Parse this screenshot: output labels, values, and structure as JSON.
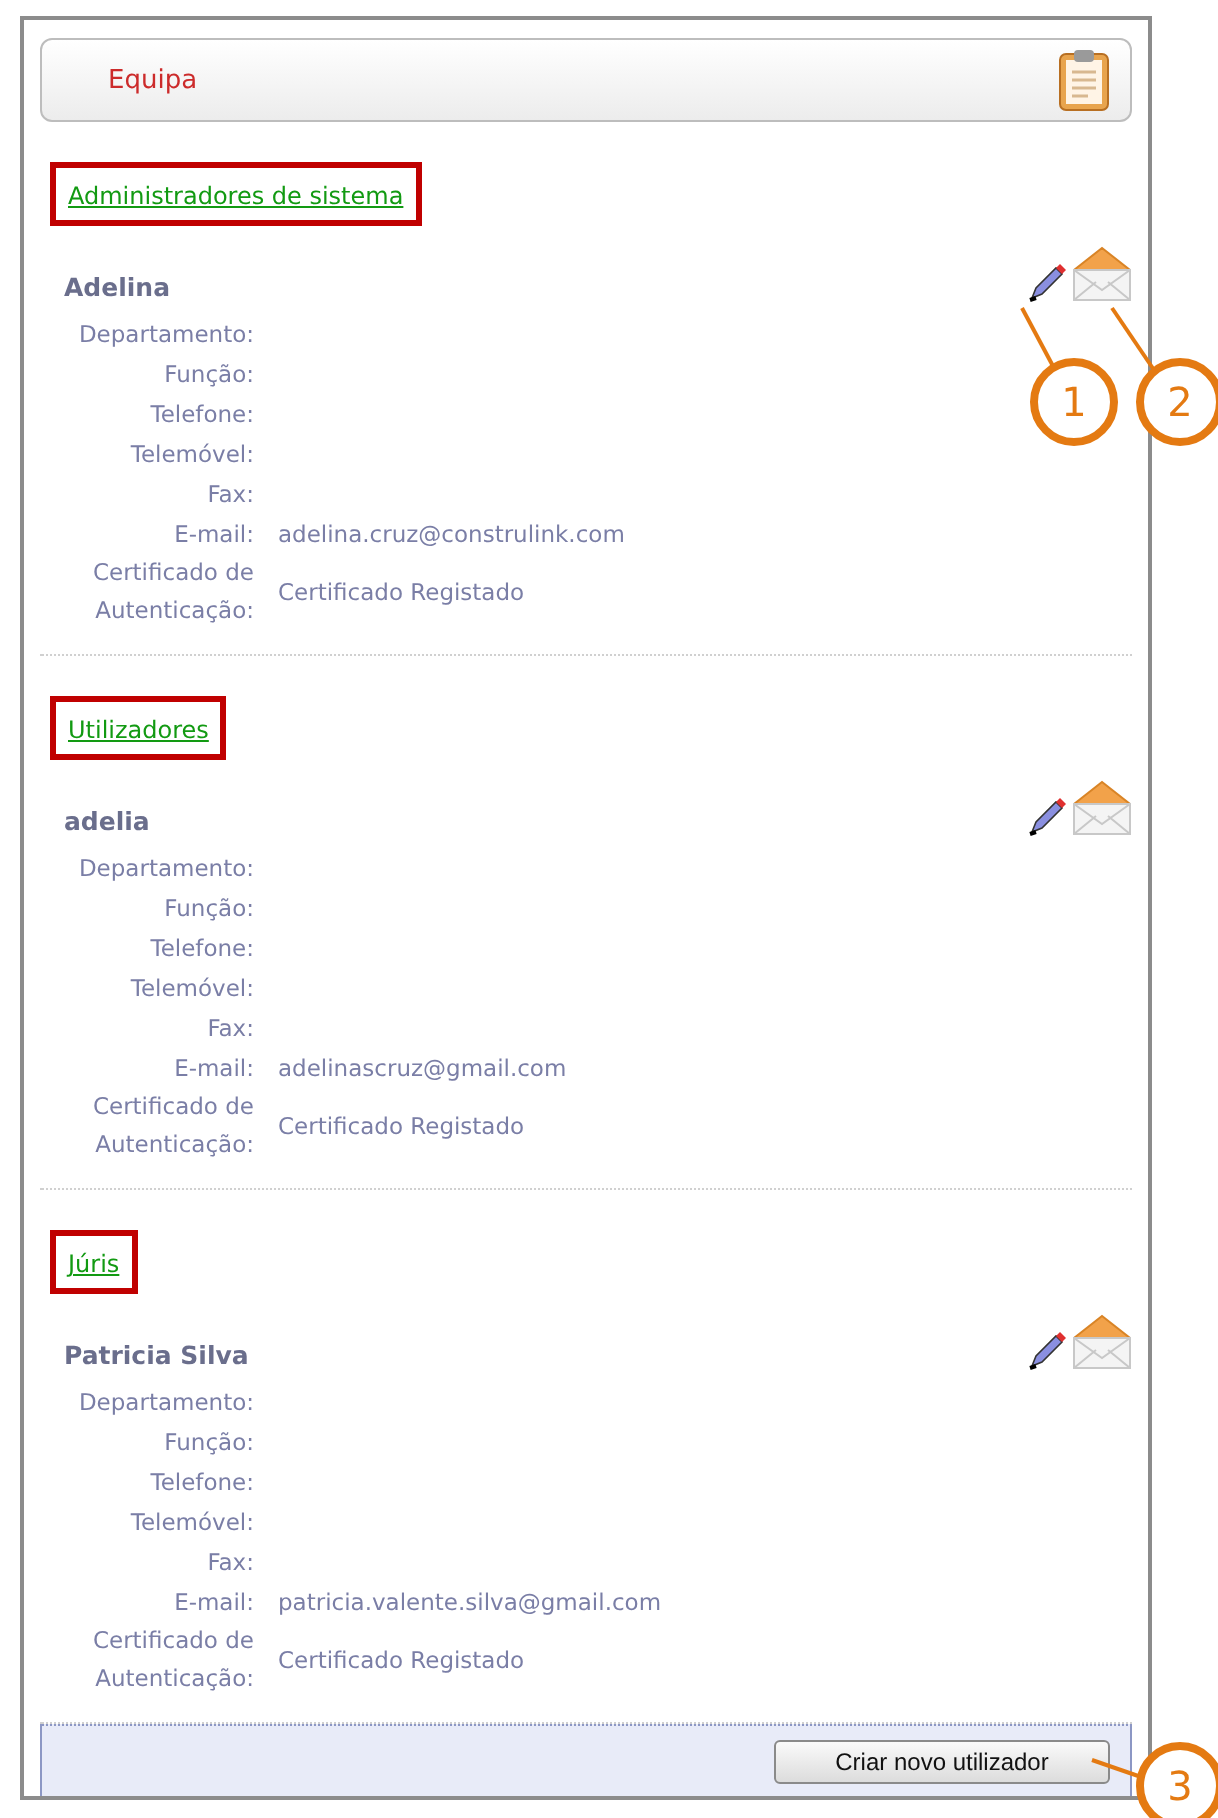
{
  "header": {
    "title": "Equipa"
  },
  "sections": [
    {
      "heading": "Administradores de sistema",
      "highlighted": true,
      "members": [
        {
          "name": "Adelina",
          "fields": [
            {
              "label": "Departamento:"
            },
            {
              "label": "Função:"
            },
            {
              "label": "Telefone:"
            },
            {
              "label": "Telemóvel:"
            },
            {
              "label": "Fax:"
            },
            {
              "label": "E-mail:",
              "value": "adelina.cruz@construlink.com"
            },
            {
              "label": "Certificado de Autenticação:",
              "value": "Certificado Registado"
            }
          ]
        }
      ]
    },
    {
      "heading": "Utilizadores",
      "highlighted": true,
      "members": [
        {
          "name": "adelia",
          "fields": [
            {
              "label": "Departamento:"
            },
            {
              "label": "Função:"
            },
            {
              "label": "Telefone:"
            },
            {
              "label": "Telemóvel:"
            },
            {
              "label": "Fax:"
            },
            {
              "label": "E-mail:",
              "value": "adelinascruz@gmail.com"
            },
            {
              "label": "Certificado de Autenticação:",
              "value": "Certificado Registado"
            }
          ]
        }
      ]
    },
    {
      "heading": "Júris",
      "highlighted": true,
      "members": [
        {
          "name": "Patricia Silva",
          "fields": [
            {
              "label": "Departamento:"
            },
            {
              "label": "Função:"
            },
            {
              "label": "Telefone:"
            },
            {
              "label": "Telemóvel:"
            },
            {
              "label": "Fax:"
            },
            {
              "label": "E-mail:",
              "value": "patricia.valente.silva@gmail.com"
            },
            {
              "label": "Certificado de Autenticação:",
              "value": "Certificado Registado"
            }
          ]
        }
      ]
    }
  ],
  "footer": {
    "button": "Criar novo utilizador"
  },
  "callouts": [
    {
      "number": "1",
      "kind": "edit"
    },
    {
      "number": "2",
      "kind": "mail"
    },
    {
      "number": "3",
      "kind": "button"
    }
  ]
}
